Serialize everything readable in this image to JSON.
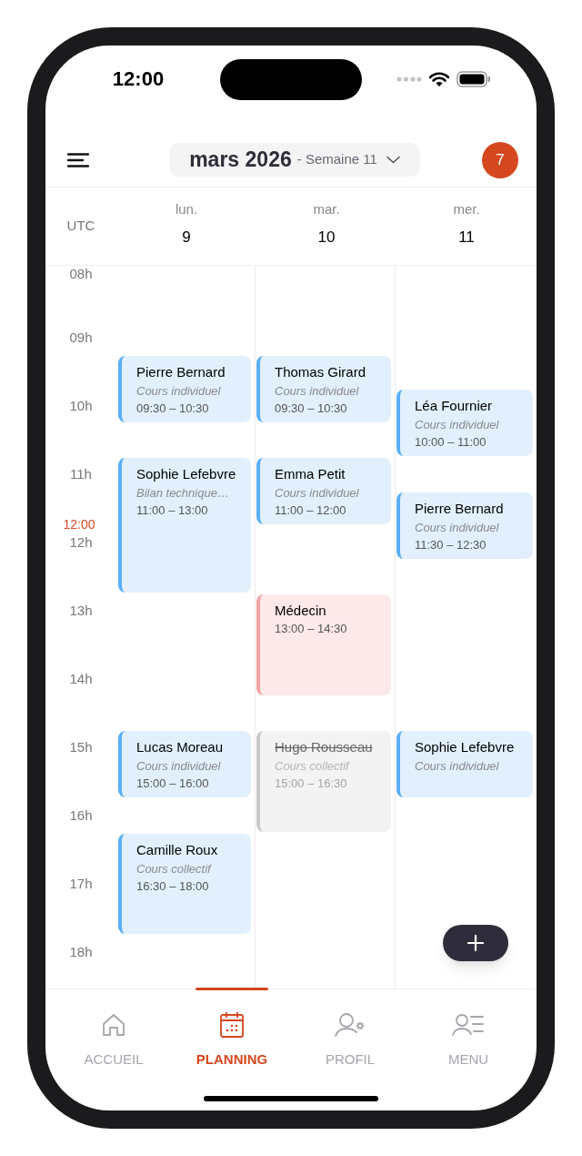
{
  "status_bar": {
    "time": "12:00"
  },
  "top_bar": {
    "title": "mars 2026",
    "subtitle": "- Semaine 11",
    "badge": "7"
  },
  "timezone": "UTC",
  "days": [
    {
      "name": "lun.",
      "date": "9",
      "events": [
        {
          "kind": "lesson",
          "name": "Pierre Bernard",
          "subtitle": "Cours individuel",
          "time": "09:30 – 10:30"
        },
        {
          "kind": "lesson",
          "name": "Sophie Lefebvre",
          "subtitle": "Bilan technique…",
          "time": "11:00 – 13:00"
        },
        {
          "kind": "lesson",
          "name": "Lucas Moreau",
          "subtitle": "Cours individuel",
          "time": "15:00 – 16:00"
        },
        {
          "kind": "lesson",
          "name": "Camille Roux",
          "subtitle": "Cours collectif",
          "time": "16:30 – 18:00"
        }
      ]
    },
    {
      "name": "mar.",
      "date": "10",
      "events": [
        {
          "kind": "lesson",
          "name": "Thomas Girard",
          "subtitle": "Cours individuel",
          "time": "09:30 – 10:30"
        },
        {
          "kind": "lesson",
          "name": "Emma Petit",
          "subtitle": "Cours individuel",
          "time": "11:00 – 12:00"
        },
        {
          "kind": "personal",
          "name": "Médecin",
          "time": "13:00 – 14:30"
        },
        {
          "kind": "cancelled",
          "name": "Hugo Rousseau",
          "subtitle": "Cours collectif",
          "time": "15:00 – 16:30"
        }
      ]
    },
    {
      "name": "mer.",
      "date": "11",
      "events": [
        {
          "kind": "lesson",
          "name": "Léa Fournier",
          "subtitle": "Cours individuel",
          "time": "10:00 – 11:00"
        },
        {
          "kind": "lesson",
          "name": "Pierre Bernard",
          "subtitle": "Cours individuel",
          "time": "11:30 – 12:30"
        },
        {
          "kind": "lesson",
          "name": "Sophie Lefebvre",
          "subtitle": "Cours individuel"
        }
      ]
    }
  ],
  "hours": [
    "08h",
    "09h",
    "10h",
    "11h",
    "12h",
    "13h",
    "14h",
    "15h",
    "16h",
    "17h",
    "18h"
  ],
  "now_label": "12:00",
  "tabs": [
    {
      "kind": "home",
      "label": "ACCUEIL",
      "selected": false
    },
    {
      "kind": "calendar",
      "label": "PLANNING",
      "selected": true
    },
    {
      "kind": "profile",
      "label": "PROFIL",
      "selected": false
    },
    {
      "kind": "menu",
      "label": "MENU",
      "selected": false
    }
  ]
}
